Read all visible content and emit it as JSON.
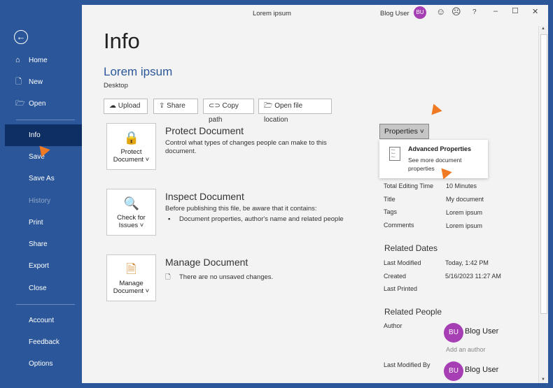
{
  "titlebar": {
    "doc_name": "Lorem ipsum",
    "user_name": "Blog User",
    "user_initials": "BU",
    "help": "?",
    "minimize": "–",
    "maximize": "☐",
    "close": "✕"
  },
  "sidebar": {
    "items": [
      {
        "label": "Home",
        "icon": "⌂"
      },
      {
        "label": "New",
        "icon": "🗋"
      },
      {
        "label": "Open",
        "icon": "🗁"
      },
      {
        "label": "Info"
      },
      {
        "label": "Save"
      },
      {
        "label": "Save As"
      },
      {
        "label": "History"
      },
      {
        "label": "Print"
      },
      {
        "label": "Share"
      },
      {
        "label": "Export"
      },
      {
        "label": "Close"
      },
      {
        "label": "Account"
      },
      {
        "label": "Feedback"
      },
      {
        "label": "Options"
      }
    ]
  },
  "main": {
    "title": "Info",
    "doc_title": "Lorem ipsum",
    "location": "Desktop",
    "actions": [
      "Upload",
      "Share",
      "Copy path",
      "Open file location"
    ],
    "sections": [
      {
        "button_line1": "Protect",
        "button_line2": "Document ˅",
        "title": "Protect Document",
        "desc": "Control what types of changes people can make to this document."
      },
      {
        "button_line1": "Check for",
        "button_line2": "Issues ˅",
        "title": "Inspect Document",
        "desc": "Before publishing this file, be aware that it contains:",
        "bullet": "Document properties, author's name and related people"
      },
      {
        "button_line1": "Manage",
        "button_line2": "Document ˅",
        "title": "Manage Document",
        "desc": "There are no unsaved changes."
      }
    ]
  },
  "properties": {
    "button": "Properties ˅",
    "menu_title": "Advanced Properties",
    "menu_desc": "See more document properties",
    "rows": [
      {
        "label": "Total Editing Time",
        "value": "10 Minutes"
      },
      {
        "label": "Title",
        "value": "My document"
      },
      {
        "label": "Tags",
        "value": "Lorem ipsum"
      },
      {
        "label": "Comments",
        "value": "Lorem ipsum"
      }
    ],
    "dates_header": "Related Dates",
    "dates": [
      {
        "label": "Last Modified",
        "value": "Today, 1:42 PM"
      },
      {
        "label": "Created",
        "value": "5/16/2023 11:27 AM"
      },
      {
        "label": "Last Printed",
        "value": ""
      }
    ],
    "people_header": "Related People",
    "author_label": "Author",
    "author": "Blog User",
    "author_initials": "BU",
    "add_author": "Add an author",
    "last_mod_label": "Last Modified By",
    "last_mod": "Blog User",
    "last_mod_initials": "BU"
  },
  "colors": {
    "sidebar": "#2b579a",
    "active": "#0e2f63",
    "avatar": "#a63fb3",
    "arrow": "#f07a24"
  }
}
